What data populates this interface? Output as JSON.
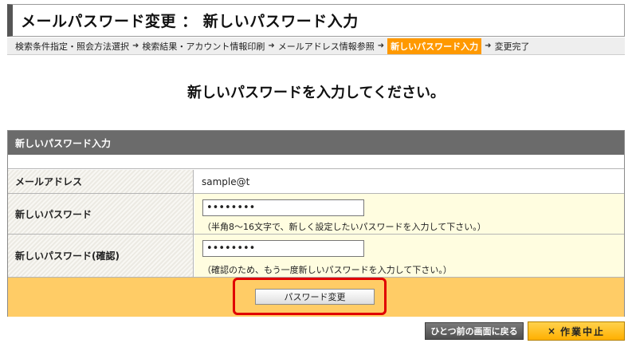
{
  "page": {
    "title": "メールパスワード変更 ： 新しいパスワード入力",
    "heading": "新しいパスワードを入力してください。"
  },
  "breadcrumb": {
    "steps": [
      "検索条件指定・照会方法選択",
      "検索結果・アカウント情報印刷",
      "メールアドレス情報参照",
      "新しいパスワード入力",
      "変更完了"
    ],
    "current_index": 3,
    "separator_icon": "arrow-right-icon"
  },
  "form": {
    "header": "新しいパスワード入力",
    "email_label": "メールアドレス",
    "email_value": "sample@t",
    "password_label": "新しいパスワード",
    "password_value": "••••••••",
    "password_hint": "（半角8～16文字で、新しく設定したいパスワードを入力して下さい。）",
    "confirm_label": "新しいパスワード(確認)",
    "confirm_value": "••••••••",
    "confirm_hint": "（確認のため、もう一度新しいパスワードを入力して下さい。）",
    "submit_label": "パスワード変更"
  },
  "footer": {
    "back_label": "ひとつ前の画面に戻る",
    "cancel_icon": "×",
    "cancel_label": "作業中止"
  },
  "colors": {
    "accent": "#ff9900",
    "header_bg": "#6b6b6b",
    "highlight": "#e00000",
    "submit_area": "#ffcc66"
  }
}
